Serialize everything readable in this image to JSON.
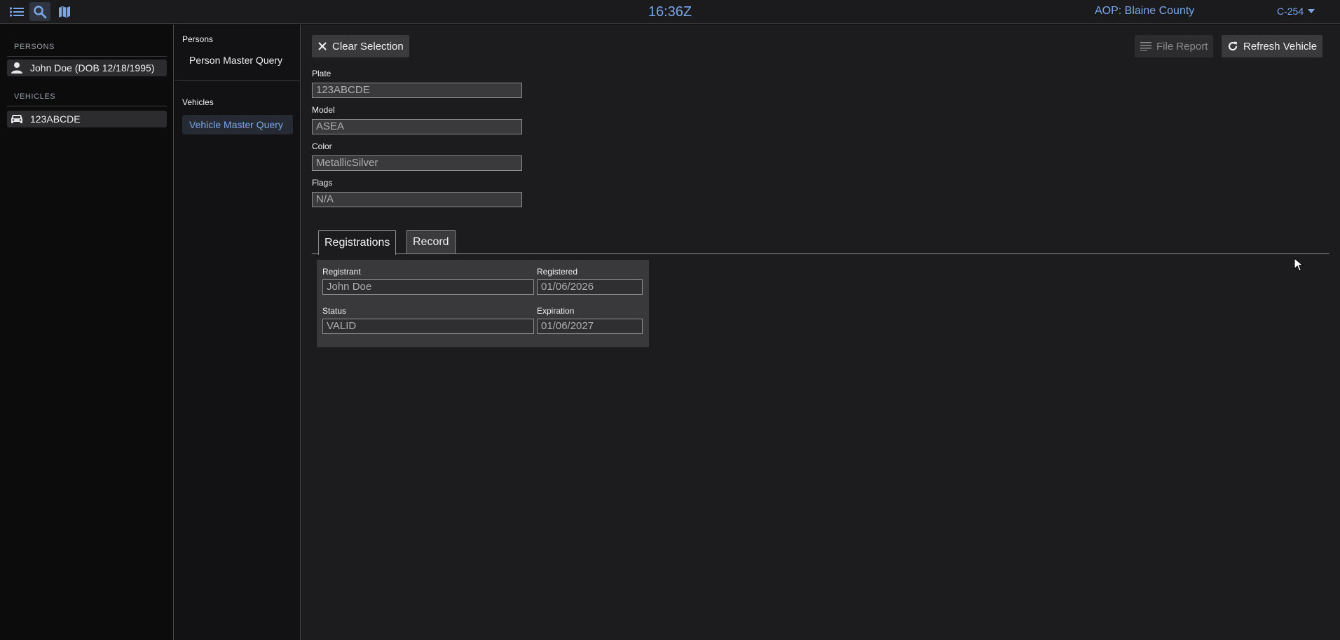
{
  "topbar": {
    "clock": "16:36Z",
    "aop": "AOP: Blaine County",
    "unit": "C-254",
    "icons": [
      "list-icon",
      "search-icon",
      "map-icon"
    ]
  },
  "sidebar": {
    "persons_title": "PERSONS",
    "person_item": "John Doe (DOB 12/18/1995)",
    "vehicles_title": "VEHICLES",
    "vehicle_item": "123ABCDE"
  },
  "query": {
    "persons_head": "Persons",
    "person_query": "Person Master Query",
    "vehicles_head": "Vehicles",
    "vehicle_query": "Vehicle Master Query"
  },
  "main": {
    "clear_label": "Clear Selection",
    "file_report_label": "File Report",
    "refresh_label": "Refresh Vehicle",
    "fields": {
      "plate_label": "Plate",
      "plate": "123ABCDE",
      "model_label": "Model",
      "model": "ASEA",
      "color_label": "Color",
      "color": "MetallicSilver",
      "flags_label": "Flags",
      "flags": "N/A"
    },
    "tabs": {
      "registrations": "Registrations",
      "record": "Record"
    },
    "registration": {
      "registrant_label": "Registrant",
      "registrant": "John Doe",
      "registered_label": "Registered",
      "registered": "01/06/2026",
      "status_label": "Status",
      "status": "VALID",
      "expiration_label": "Expiration",
      "expiration": "01/06/2027"
    }
  },
  "colors": {
    "accent": "#7aa7e8",
    "background": "#1c1c1e",
    "sidebar": "#0c0c0d"
  }
}
